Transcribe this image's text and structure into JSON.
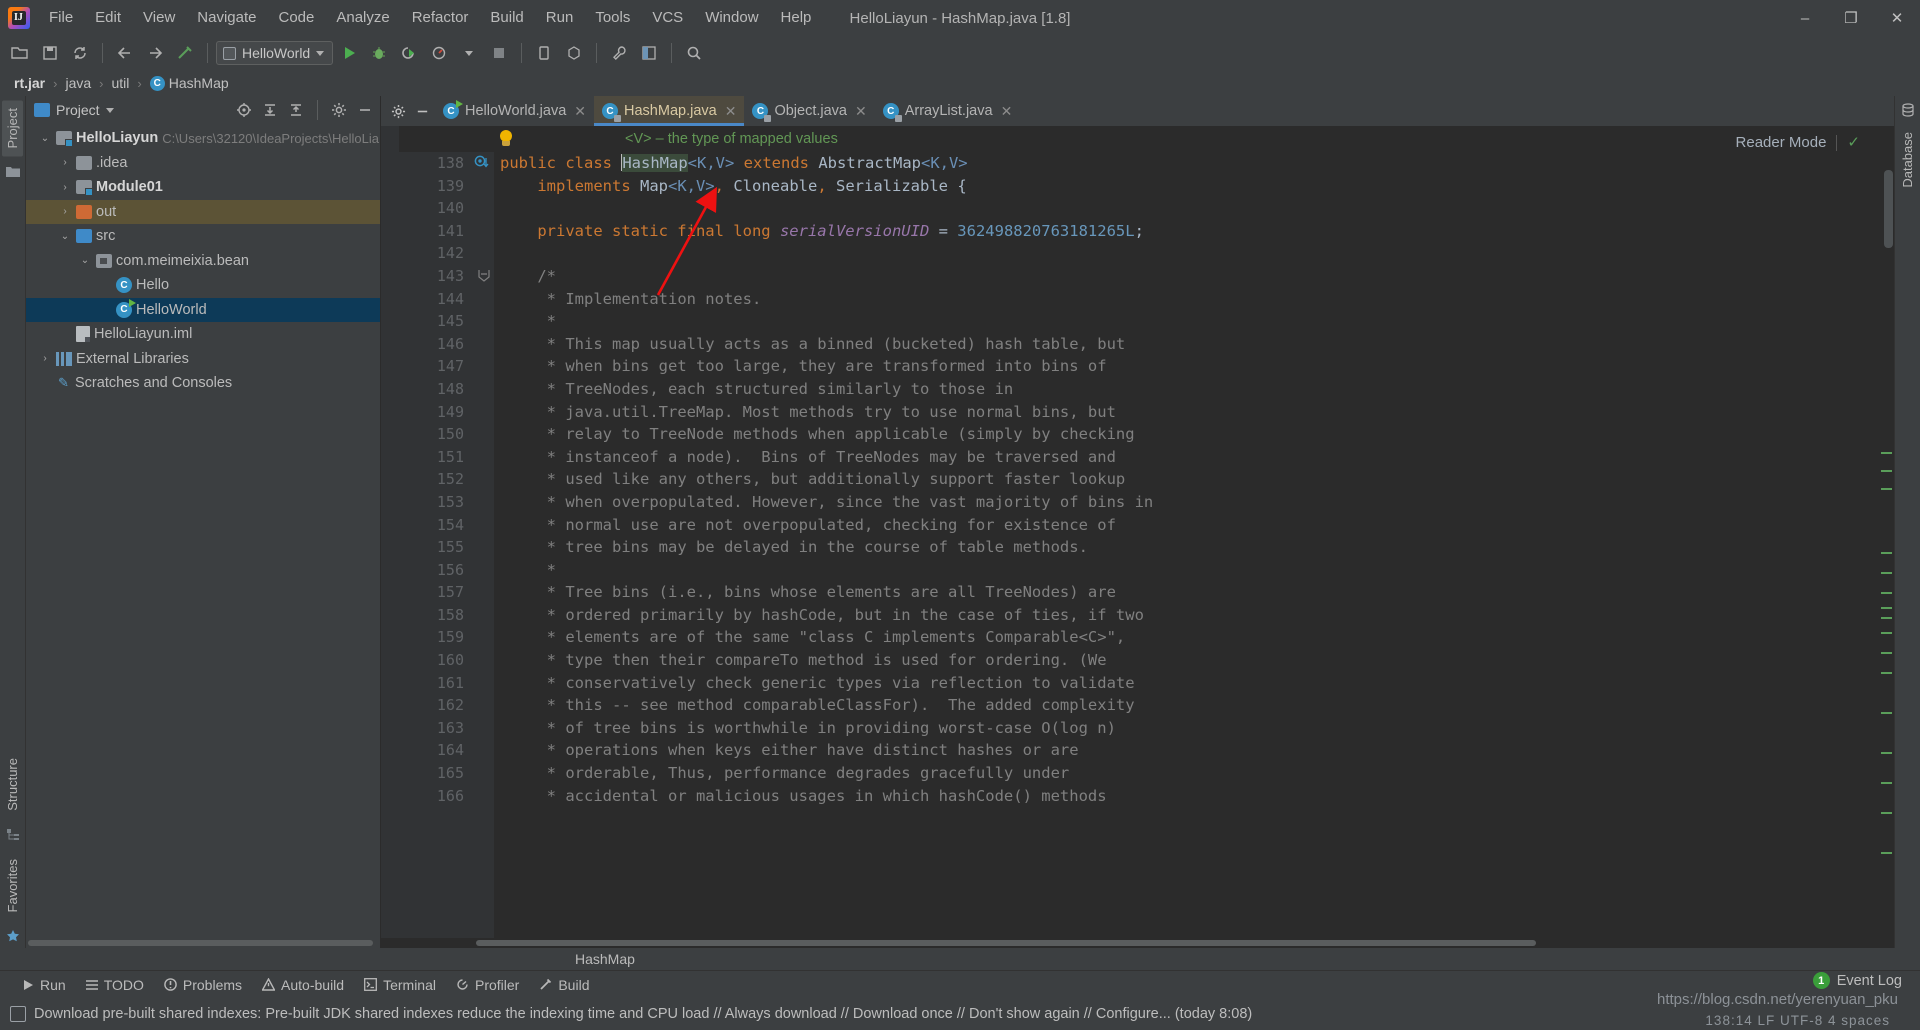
{
  "window": {
    "title": "HelloLiayun - HashMap.java [1.8]",
    "minimize": "–",
    "maximize": "❐",
    "close": "✕"
  },
  "menubar": [
    {
      "label": "File"
    },
    {
      "label": "Edit"
    },
    {
      "label": "View"
    },
    {
      "label": "Navigate"
    },
    {
      "label": "Code"
    },
    {
      "label": "Analyze"
    },
    {
      "label": "Refactor"
    },
    {
      "label": "Build"
    },
    {
      "label": "Run"
    },
    {
      "label": "Tools"
    },
    {
      "label": "VCS"
    },
    {
      "label": "Window"
    },
    {
      "label": "Help"
    }
  ],
  "toolbar": {
    "run_config": "HelloWorld",
    "icons": [
      "open-folder-icon",
      "save-icon",
      "sync-icon",
      "back-arrow-icon",
      "forward-arrow-icon",
      "build-hammer-icon",
      "run-icon",
      "debug-icon",
      "run-coverage-icon",
      "profile-icon",
      "stop-icon",
      "device-manager-icon",
      "avd-manager-icon",
      "settings-wrench-icon",
      "project-structure-icon",
      "search-everywhere-icon"
    ]
  },
  "breadcrumb": {
    "items": [
      "rt.jar",
      "java",
      "util",
      "HashMap"
    ],
    "separator": "›"
  },
  "project_panel": {
    "title": "Project",
    "tool_icons": [
      "locate-icon",
      "expand-all-icon",
      "collapse-all-icon",
      "settings-gear-icon",
      "hide-icon"
    ],
    "tree": [
      {
        "label": "HelloLiayun",
        "detail": "C:\\Users\\32120\\IdeaProjects\\HelloLia",
        "indent": 0,
        "arrow": "expanded",
        "icon": "module-folder-icon",
        "bold": true,
        "state": "normal"
      },
      {
        "label": ".idea",
        "detail": "",
        "indent": 1,
        "arrow": "collapsed",
        "icon": "folder-icon",
        "bold": false,
        "state": "normal"
      },
      {
        "label": "Module01",
        "detail": "",
        "indent": 1,
        "arrow": "collapsed",
        "icon": "module-folder-icon",
        "bold": true,
        "state": "normal"
      },
      {
        "label": "out",
        "detail": "",
        "indent": 1,
        "arrow": "collapsed",
        "icon": "output-folder-icon",
        "bold": false,
        "state": "highlight"
      },
      {
        "label": "src",
        "detail": "",
        "indent": 1,
        "arrow": "expanded",
        "icon": "source-folder-icon",
        "bold": false,
        "state": "normal"
      },
      {
        "label": "com.meimeixia.bean",
        "detail": "",
        "indent": 2,
        "arrow": "expanded",
        "icon": "package-icon",
        "bold": false,
        "state": "normal"
      },
      {
        "label": "Hello",
        "detail": "",
        "indent": 3,
        "arrow": "none",
        "icon": "java-class-icon",
        "bold": false,
        "state": "normal"
      },
      {
        "label": "HelloWorld",
        "detail": "",
        "indent": 3,
        "arrow": "none",
        "icon": "java-class-runnable-icon",
        "bold": false,
        "state": "selected"
      },
      {
        "label": "HelloLiayun.iml",
        "detail": "",
        "indent": 1,
        "arrow": "none",
        "icon": "iml-file-icon",
        "bold": false,
        "state": "normal"
      },
      {
        "label": "External Libraries",
        "detail": "",
        "indent": 0,
        "arrow": "collapsed",
        "icon": "libraries-icon",
        "bold": false,
        "state": "normal"
      },
      {
        "label": "Scratches and Consoles",
        "detail": "",
        "indent": 0,
        "arrow": "none",
        "icon": "scratches-icon",
        "bold": false,
        "state": "normal"
      }
    ]
  },
  "editor": {
    "tabs": [
      {
        "label": "HelloWorld.java",
        "icon": "java-class-runnable-icon",
        "active": false,
        "close": "✕"
      },
      {
        "label": "HashMap.java",
        "icon": "java-class-readonly-icon",
        "active": true,
        "close": "✕"
      },
      {
        "label": "Object.java",
        "icon": "java-class-readonly-icon",
        "active": false,
        "close": "✕"
      },
      {
        "label": "ArrayList.java",
        "icon": "java-class-readonly-icon",
        "active": false,
        "close": "✕"
      }
    ],
    "param_hint": "<V> – the type of mapped values",
    "reader_mode_label": "Reader Mode",
    "reader_mode_check": "✓",
    "first_line_number": 138,
    "lines": [
      {
        "n": 138,
        "html": "<span class=\"kw\">public class </span><span class=\"sel-tok\">HashMap</span><span class=\"gen\">&lt;K,V&gt;</span> <span class=\"kw\">extends </span>AbstractMap<span class=\"gen\">&lt;K,V&gt;</span>",
        "marker": "override-icon"
      },
      {
        "n": 139,
        "html": "    <span class=\"kw\">implements </span>Map<span class=\"gen\">&lt;K,V&gt;</span><span class=\"kw\">,</span> Cloneable<span class=\"kw\">,</span> Serializable {",
        "marker": ""
      },
      {
        "n": 140,
        "html": "",
        "marker": ""
      },
      {
        "n": 141,
        "html": "    <span class=\"kw\">private static final long </span><span class=\"fld\">serialVersionUID </span>= <span class=\"num\">362498820763181265L</span>;",
        "marker": ""
      },
      {
        "n": 142,
        "html": "",
        "marker": ""
      },
      {
        "n": 143,
        "html": "    <span class=\"cm\">/*</span>",
        "marker": "fold-icon"
      },
      {
        "n": 144,
        "html": "     <span class=\"cm\">* Implementation notes.</span>",
        "marker": ""
      },
      {
        "n": 145,
        "html": "     <span class=\"cm\">*</span>",
        "marker": ""
      },
      {
        "n": 146,
        "html": "     <span class=\"cm\">* This map usually acts as a binned (bucketed) hash table, but</span>",
        "marker": ""
      },
      {
        "n": 147,
        "html": "     <span class=\"cm\">* when bins get too large, they are transformed into bins of</span>",
        "marker": ""
      },
      {
        "n": 148,
        "html": "     <span class=\"cm\">* TreeNodes, each structured similarly to those in</span>",
        "marker": ""
      },
      {
        "n": 149,
        "html": "     <span class=\"cm\">* java.util.TreeMap. Most methods try to use normal bins, but</span>",
        "marker": ""
      },
      {
        "n": 150,
        "html": "     <span class=\"cm\">* relay to TreeNode methods when applicable (simply by checking</span>",
        "marker": ""
      },
      {
        "n": 151,
        "html": "     <span class=\"cm\">* instanceof a node).  Bins of TreeNodes may be traversed and</span>",
        "marker": ""
      },
      {
        "n": 152,
        "html": "     <span class=\"cm\">* used like any others, but additionally support faster lookup</span>",
        "marker": ""
      },
      {
        "n": 153,
        "html": "     <span class=\"cm\">* when overpopulated. However, since the vast majority of bins in</span>",
        "marker": ""
      },
      {
        "n": 154,
        "html": "     <span class=\"cm\">* normal use are not overpopulated, checking for existence of</span>",
        "marker": ""
      },
      {
        "n": 155,
        "html": "     <span class=\"cm\">* tree bins may be delayed in the course of table methods.</span>",
        "marker": ""
      },
      {
        "n": 156,
        "html": "     <span class=\"cm\">*</span>",
        "marker": ""
      },
      {
        "n": 157,
        "html": "     <span class=\"cm\">* Tree bins (i.e., bins whose elements are all TreeNodes) are</span>",
        "marker": ""
      },
      {
        "n": 158,
        "html": "     <span class=\"cm\">* ordered primarily by hashCode, but in the case of ties, if two</span>",
        "marker": ""
      },
      {
        "n": 159,
        "html": "     <span class=\"cm\">* elements are of the same \"class C implements Comparable&lt;C&gt;\",</span>",
        "marker": ""
      },
      {
        "n": 160,
        "html": "     <span class=\"cm\">* type then their compareTo method is used for ordering. (We</span>",
        "marker": ""
      },
      {
        "n": 161,
        "html": "     <span class=\"cm\">* conservatively check generic types via reflection to validate</span>",
        "marker": ""
      },
      {
        "n": 162,
        "html": "     <span class=\"cm\">* this -- see method comparableClassFor).  The added complexity</span>",
        "marker": ""
      },
      {
        "n": 163,
        "html": "     <span class=\"cm\">* of tree bins is worthwhile in providing worst-case O(log n)</span>",
        "marker": ""
      },
      {
        "n": 164,
        "html": "     <span class=\"cm\">* operations when keys either have distinct hashes or are</span>",
        "marker": ""
      },
      {
        "n": 165,
        "html": "     <span class=\"cm\">* orderable, Thus, performance degrades gracefully under</span>",
        "marker": ""
      },
      {
        "n": 166,
        "html": "     <span class=\"cm\">* accidental or malicious usages in which hashCode() methods</span>",
        "marker": ""
      }
    ]
  },
  "rails": {
    "left_top": "Project",
    "left_bottom_1": "Structure",
    "left_bottom_2": "Favorites",
    "right": "Database"
  },
  "bottom": {
    "current_element": "HashMap",
    "tool_buttons": [
      {
        "label": "Run",
        "icon": "run-icon"
      },
      {
        "label": "TODO",
        "icon": "todo-icon"
      },
      {
        "label": "Problems",
        "icon": "problems-icon"
      },
      {
        "label": "Auto-build",
        "icon": "warning-icon"
      },
      {
        "label": "Terminal",
        "icon": "terminal-icon"
      },
      {
        "label": "Profiler",
        "icon": "profiler-icon"
      },
      {
        "label": "Build",
        "icon": "build-hammer-icon"
      }
    ],
    "notification": "Download pre-built shared indexes: Pre-built JDK shared indexes reduce the indexing time and CPU load // Always download // Download once // Don't show again // Configure... (today 8:08)",
    "event_log": {
      "label": "Event Log",
      "count": "1"
    },
    "status_right": "138:14   LF   UTF-8   4 spaces",
    "watermark": "https://blog.csdn.net/yerenyuan_pku"
  }
}
